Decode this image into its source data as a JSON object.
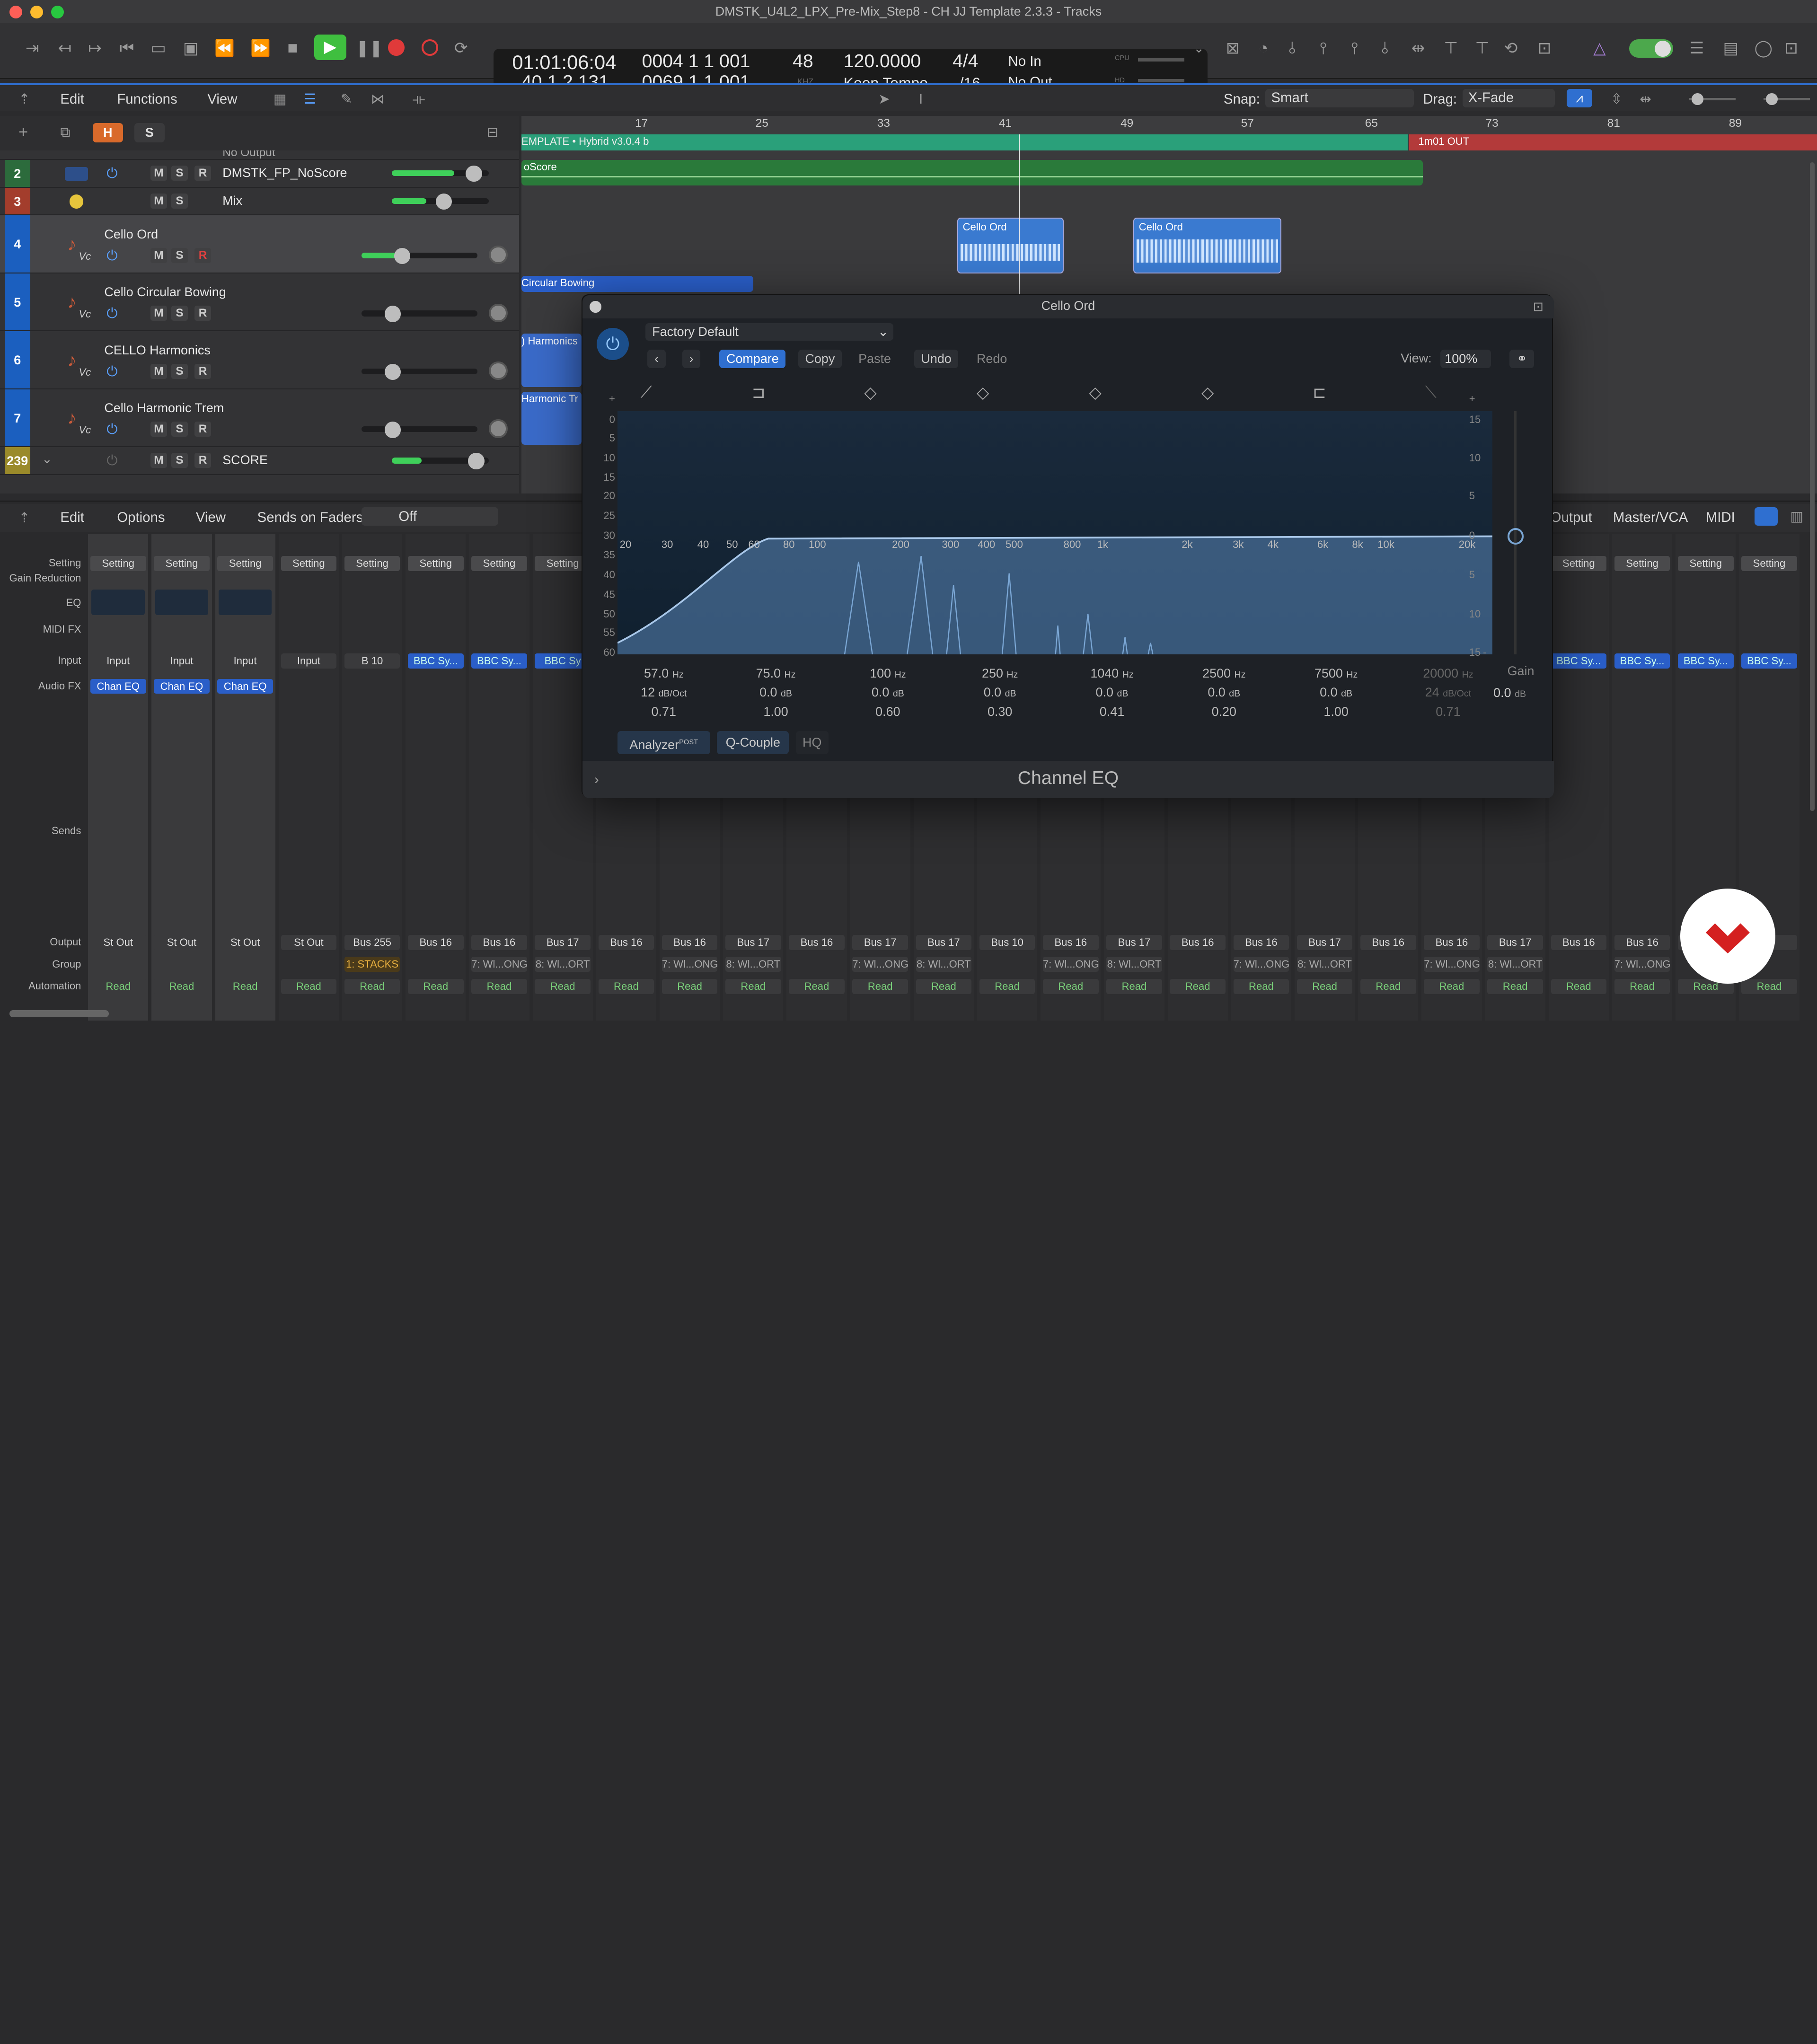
{
  "window": {
    "title": "DMSTK_U4L2_LPX_Pre-Mix_Step8 - CH JJ Template 2.3.3 - Tracks"
  },
  "lcd": {
    "smpte": "01:01:06:04",
    "bars": "40 1 2 131",
    "pos1": "0004 1 1 001",
    "pos2": "0069 1 1 001",
    "khz_val": "48",
    "khz_unit": "KHZ",
    "tempo": "120.0000",
    "tempo_mode": "Keep Tempo",
    "sig": "4/4",
    "div": "/16",
    "in": "No In",
    "out": "No Out",
    "cpu": "CPU",
    "hd": "HD"
  },
  "menubar": {
    "edit": "Edit",
    "functions": "Functions",
    "view": "View",
    "snap_label": "Snap:",
    "snap_val": "Smart",
    "drag_label": "Drag:",
    "drag_val": "X-Fade"
  },
  "tracklist": {
    "h": "H",
    "s": "S",
    "tracks": [
      {
        "num": "",
        "name": "No Output"
      },
      {
        "num": "2",
        "name": "DMSTK_FP_NoScore"
      },
      {
        "num": "3",
        "name": "Mix"
      },
      {
        "num": "4",
        "name": "Cello Ord"
      },
      {
        "num": "5",
        "name": "Cello Circular Bowing"
      },
      {
        "num": "6",
        "name": "CELLO Harmonics"
      },
      {
        "num": "7",
        "name": "Cello Harmonic Trem"
      },
      {
        "num": "239",
        "name": "SCORE"
      }
    ],
    "m": "M",
    "s_btn": "S",
    "r": "R",
    "vc": "Vc"
  },
  "ruler": [
    "17",
    "25",
    "33",
    "41",
    "49",
    "57",
    "65",
    "73",
    "81",
    "89"
  ],
  "regions": {
    "template": "EMPLATE • Hybrid v3.0.4 b",
    "noscore": "oScore",
    "cello1": "Cello Ord",
    "cello2": "Cello Ord",
    "circ": "Circular Bowing",
    "harm": ") Harmonics",
    "harmtr": "Harmonic Tr",
    "out": "1m01 OUT"
  },
  "mixer_bar": {
    "edit": "Edit",
    "options": "Options",
    "view": "View",
    "sends": "Sends on Faders:",
    "off": "Off",
    "output": "Output",
    "master": "Master/VCA",
    "midi": "MIDI"
  },
  "mixer_labels": {
    "setting": "Setting",
    "gain": "Gain Reduction",
    "eq": "EQ",
    "midifx": "MIDI FX",
    "input": "Input",
    "audiofx": "Audio FX",
    "sends": "Sends",
    "output": "Output",
    "group": "Group",
    "automation": "Automation"
  },
  "strips": [
    {
      "set": "Setting",
      "inp": "Input",
      "fx": "Chan EQ",
      "out": "St Out",
      "grp": "",
      "auto": "Read"
    },
    {
      "set": "Setting",
      "inp": "Input",
      "fx": "Chan EQ",
      "out": "St Out",
      "grp": "",
      "auto": "Read"
    },
    {
      "set": "Setting",
      "inp": "Input",
      "fx": "Chan EQ",
      "out": "St Out",
      "grp": "",
      "auto": "Read"
    },
    {
      "set": "Setting",
      "inp": "Input",
      "fx": "",
      "out": "St Out",
      "grp": "",
      "auto": "Read"
    },
    {
      "set": "Setting",
      "inp": "B 10",
      "fx": "",
      "out": "Bus 255",
      "grp": "1: STACKS",
      "auto": "Read"
    },
    {
      "set": "Setting",
      "inp": "BBC Sy...",
      "fx": "",
      "out": "Bus 16",
      "grp": "",
      "auto": "Read"
    },
    {
      "set": "Setting",
      "inp": "BBC Sy...",
      "fx": "",
      "out": "Bus 16",
      "grp": "7: Wl...ONG",
      "auto": "Read"
    },
    {
      "set": "Setting",
      "inp": "BBC Sy",
      "fx": "",
      "out": "Bus 17",
      "grp": "8: Wl...ORT",
      "auto": "Read"
    },
    {
      "set": "",
      "inp": "",
      "fx": "",
      "out": "Bus 16",
      "grp": "",
      "auto": "Read"
    },
    {
      "set": "",
      "inp": "",
      "fx": "",
      "out": "Bus 16",
      "grp": "7: Wl...ONG",
      "auto": "Read"
    },
    {
      "set": "",
      "inp": "",
      "fx": "",
      "out": "Bus 17",
      "grp": "8: Wl...ORT",
      "auto": "Read"
    },
    {
      "set": "",
      "inp": "",
      "fx": "",
      "out": "Bus 16",
      "grp": "",
      "auto": "Read"
    },
    {
      "set": "",
      "inp": "",
      "fx": "",
      "out": "Bus 17",
      "grp": "7: Wl...ONG",
      "auto": "Read"
    },
    {
      "set": "",
      "inp": "",
      "fx": "",
      "out": "Bus 17",
      "grp": "8: Wl...ORT",
      "auto": "Read"
    },
    {
      "set": "",
      "inp": "",
      "fx": "",
      "out": "Bus 10",
      "grp": "",
      "auto": "Read"
    },
    {
      "set": "",
      "inp": "",
      "fx": "",
      "out": "Bus 16",
      "grp": "7: Wl...ONG",
      "auto": "Read"
    },
    {
      "set": "",
      "inp": "",
      "fx": "",
      "out": "Bus 17",
      "grp": "8: Wl...ORT",
      "auto": "Read"
    },
    {
      "set": "",
      "inp": "",
      "fx": "",
      "out": "Bus 16",
      "grp": "",
      "auto": "Read"
    },
    {
      "set": "",
      "inp": "",
      "fx": "",
      "out": "Bus 16",
      "grp": "7: Wl...ONG",
      "auto": "Read"
    },
    {
      "set": "",
      "inp": "",
      "fx": "",
      "out": "Bus 17",
      "grp": "8: Wl...ORT",
      "auto": "Read"
    },
    {
      "set": "",
      "inp": "",
      "fx": "",
      "out": "Bus 16",
      "grp": "",
      "auto": "Read"
    },
    {
      "set": "",
      "inp": "",
      "fx": "",
      "out": "Bus 16",
      "grp": "7: Wl...ONG",
      "auto": "Read"
    },
    {
      "set": "",
      "inp": "",
      "fx": "",
      "out": "Bus 17",
      "grp": "8: Wl...ORT",
      "auto": "Read"
    },
    {
      "set": "Setting",
      "inp": "BBC Sy...",
      "fx": "",
      "out": "Bus 16",
      "grp": "",
      "auto": "Read"
    },
    {
      "set": "Setting",
      "inp": "BBC Sy...",
      "fx": "",
      "out": "Bus 16",
      "grp": "7: Wl...ONG",
      "auto": "Read"
    },
    {
      "set": "Setting",
      "inp": "BBC Sy...",
      "fx": "",
      "out": "Bus 16",
      "grp": "",
      "auto": "Read"
    },
    {
      "set": "Setting",
      "inp": "BBC Sy...",
      "fx": "",
      "out": "16",
      "grp": "",
      "auto": "Read"
    }
  ],
  "plugin": {
    "title": "Cello Ord",
    "preset": "Factory Default",
    "compare": "Compare",
    "copy": "Copy",
    "paste": "Paste",
    "undo": "Undo",
    "redo": "Redo",
    "view_label": "View:",
    "view_val": "100%",
    "name": "Channel EQ",
    "analyzer": "Analyzer",
    "post": "POST",
    "qcouple": "Q-Couple",
    "hq": "HQ",
    "gain_label": "Gain",
    "gain_val": "0.0",
    "db": "dB"
  },
  "eq_scale_left": [
    "+",
    "0",
    "5",
    "10",
    "15",
    "20",
    "25",
    "30",
    "35",
    "40",
    "45",
    "50",
    "55",
    "60"
  ],
  "eq_scale_right": [
    "+",
    "15",
    "10",
    "5",
    "0",
    "5",
    "10",
    "15",
    "-"
  ],
  "eq_freqs": [
    "20",
    "30",
    "40",
    "50",
    "60",
    "80",
    "100",
    "200",
    "300",
    "400",
    "500",
    "800",
    "1k",
    "2k",
    "3k",
    "4k",
    "6k",
    "8k",
    "10k",
    "20k"
  ],
  "bands": [
    {
      "freq": "57.0",
      "unit": "Hz",
      "gain": "12",
      "gunit": "dB/Oct",
      "q": "0.71"
    },
    {
      "freq": "75.0",
      "unit": "Hz",
      "gain": "0.0",
      "gunit": "dB",
      "q": "1.00"
    },
    {
      "freq": "100",
      "unit": "Hz",
      "gain": "0.0",
      "gunit": "dB",
      "q": "0.60"
    },
    {
      "freq": "250",
      "unit": "Hz",
      "gain": "0.0",
      "gunit": "dB",
      "q": "0.30"
    },
    {
      "freq": "1040",
      "unit": "Hz",
      "gain": "0.0",
      "gunit": "dB",
      "q": "0.41"
    },
    {
      "freq": "2500",
      "unit": "Hz",
      "gain": "0.0",
      "gunit": "dB",
      "q": "0.20"
    },
    {
      "freq": "7500",
      "unit": "Hz",
      "gain": "0.0",
      "gunit": "dB",
      "q": "1.00"
    },
    {
      "freq": "20000",
      "unit": "Hz",
      "gain": "24",
      "gunit": "dB/Oct",
      "q": "0.71"
    }
  ],
  "colors": {
    "accent": "#2f6fd0",
    "play": "#3fbf3f",
    "record": "#e03a3a",
    "track_blue": "#1b5fbf",
    "region_green": "#2a8a5a"
  }
}
